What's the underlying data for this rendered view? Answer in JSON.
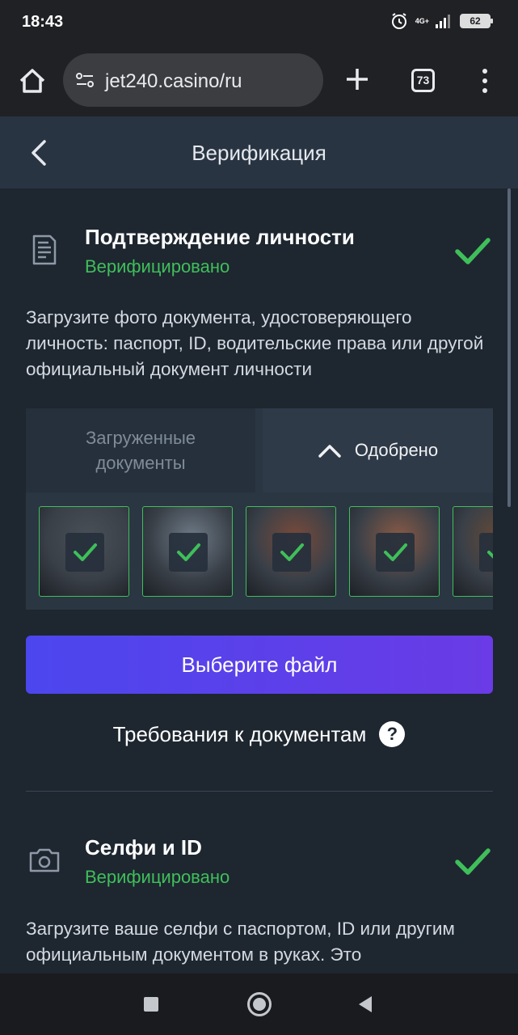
{
  "status": {
    "time": "18:43",
    "network": "4G+",
    "battery": "62"
  },
  "browser": {
    "url": "jet240.casino/ru",
    "tab_count": "73"
  },
  "header": {
    "title": "Верификация"
  },
  "identity": {
    "title": "Подтверждение личности",
    "status": "Верифицировано",
    "description": "Загрузите фото документа, удостоверяющего личность: паспорт, ID, водительские права или другой официальный документ личности",
    "tabs": {
      "uploaded": "Загруженные документы",
      "approved": "Одобрено"
    },
    "documents": [
      {
        "name": "document-1",
        "tone": "#4a5058"
      },
      {
        "name": "document-2",
        "tone": "#6e7b88"
      },
      {
        "name": "document-3",
        "tone": "#7a4a3a"
      },
      {
        "name": "document-4",
        "tone": "#8a5a45"
      },
      {
        "name": "document-5",
        "tone": "#6a4a35"
      }
    ],
    "choose_file": "Выберите файл",
    "requirements": "Требования к документам",
    "help_glyph": "?"
  },
  "selfie": {
    "title": "Селфи и ID",
    "status": "Верифицировано",
    "description": "Загрузите ваше селфи с паспортом, ID или другим официальным документом в руках. Это"
  },
  "colors": {
    "verified_green": "#3fbf5a",
    "button_start": "#4c46ee",
    "button_end": "#6a3be6",
    "page_bg": "#1e2630",
    "header_bg": "#293442"
  }
}
